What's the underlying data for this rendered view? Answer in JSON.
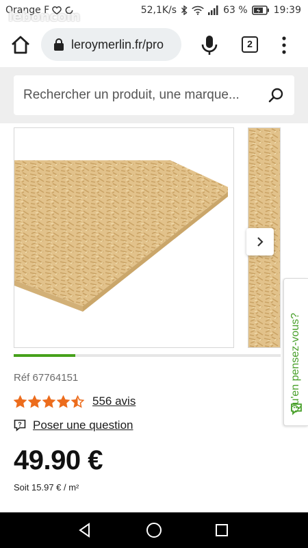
{
  "status_bar": {
    "carrier": "Orange F",
    "speed": "52,1K/s",
    "battery": "63 %",
    "time": "19:39"
  },
  "watermark": "leboncoin",
  "browser": {
    "url": "leroymerlin.fr/pro",
    "tab_count": "2"
  },
  "search": {
    "placeholder": "Rechercher un produit, une marque..."
  },
  "gallery": {
    "current_index_fraction": 0.23,
    "feedback_label": "Qu'en pensez-vous?"
  },
  "product": {
    "reference": "Réf 67764151",
    "rating": 4.5,
    "rating_max": 5,
    "reviews": "556 avis",
    "question_link": "Poser une question",
    "price": "49.90 €",
    "unit_price": "Soit 15.97 € / m²"
  },
  "colors": {
    "brand_green": "#46a11b",
    "star_orange": "#ec6c1c"
  },
  "icons": {
    "home": "home-icon",
    "lock": "lock-icon",
    "mic": "microphone-icon",
    "menu": "more-vertical-icon",
    "search": "search-icon",
    "next": "chevron-right-icon",
    "question": "question-bubble-icon"
  }
}
